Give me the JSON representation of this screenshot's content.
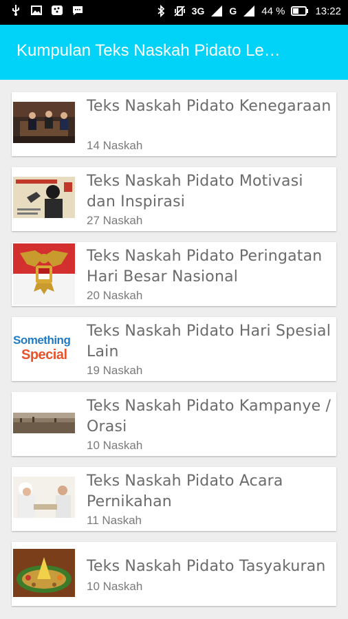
{
  "status_bar": {
    "network_1": "3G",
    "network_2": "G",
    "battery": "44 %",
    "time": "13:22"
  },
  "app_bar": {
    "title": "Kumpulan Teks Naskah Pidato Le…"
  },
  "items": [
    {
      "title": "Teks Naskah Pidato Kenegaraan",
      "count": "14 Naskah",
      "thumb": "state-speech-photo"
    },
    {
      "title": "Teks Naskah Pidato Motivasi dan Inspirasi",
      "count": "27 Naskah",
      "thumb": "motivation-photo"
    },
    {
      "title": "Teks Naskah Pidato Peringatan Hari Besar Nasional",
      "count": "20 Naskah",
      "thumb": "garuda-emblem"
    },
    {
      "title": "Teks Naskah Pidato Hari Spesial Lain",
      "count": "19 Naskah",
      "thumb": "something-special-logo",
      "thumb_text_1": "Something",
      "thumb_text_2": "Special"
    },
    {
      "title": "Teks Naskah Pidato Kampanye / Orasi",
      "count": "10 Naskah",
      "thumb": "crowd-photo"
    },
    {
      "title": "Teks Naskah Pidato Acara Pernikahan",
      "count": "11 Naskah",
      "thumb": "wedding-photo"
    },
    {
      "title": "Teks Naskah Pidato Tasyakuran",
      "count": "10 Naskah",
      "thumb": "tumpeng-photo"
    }
  ],
  "colors": {
    "app_bar": "#00d2f8",
    "background": "#eeeeee",
    "text": "#6b6b6b"
  }
}
